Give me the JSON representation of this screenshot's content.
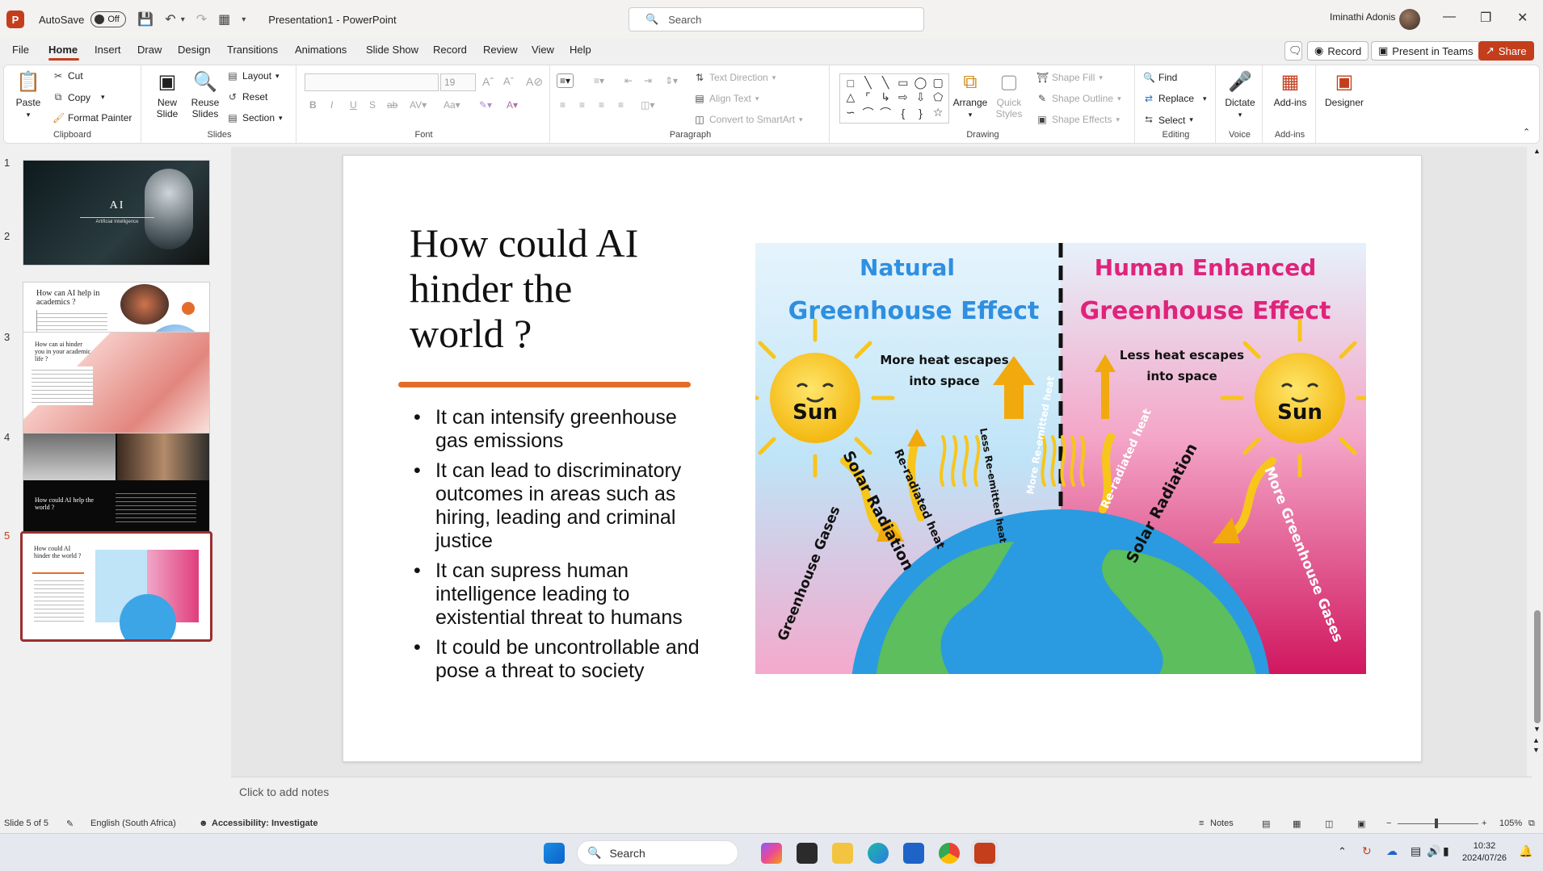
{
  "titlebar": {
    "autosave_label": "AutoSave",
    "autosave_state": "Off",
    "doc_title": "Presentation1 - PowerPoint",
    "search_placeholder": "Search",
    "user_name": "Iminathi Adonis"
  },
  "menu": {
    "tabs": [
      "File",
      "Home",
      "Insert",
      "Draw",
      "Design",
      "Transitions",
      "Animations",
      "Slide Show",
      "Record",
      "Review",
      "View",
      "Help"
    ],
    "record_btn": "Record",
    "present_btn": "Present in Teams",
    "share_btn": "Share"
  },
  "ribbon": {
    "clipboard": {
      "paste": "Paste",
      "cut": "Cut",
      "copy": "Copy",
      "format_painter": "Format Painter",
      "label": "Clipboard"
    },
    "slides": {
      "new_slide": "New Slide",
      "reuse_slides": "Reuse Slides",
      "layout": "Layout",
      "reset": "Reset",
      "section": "Section",
      "label": "Slides"
    },
    "font": {
      "size": "19",
      "label": "Font"
    },
    "paragraph": {
      "text_direction": "Text Direction",
      "align_text": "Align Text",
      "smartart": "Convert to SmartArt",
      "label": "Paragraph"
    },
    "drawing": {
      "arrange": "Arrange",
      "quick_styles": "Quick Styles",
      "shape_fill": "Shape Fill",
      "shape_outline": "Shape Outline",
      "shape_effects": "Shape Effects",
      "label": "Drawing"
    },
    "editing": {
      "find": "Find",
      "replace": "Replace",
      "select": "Select",
      "label": "Editing"
    },
    "voice": {
      "dictate": "Dictate",
      "label": "Voice"
    },
    "addins": {
      "addins": "Add-ins",
      "label": "Add-ins"
    },
    "designer": {
      "designer": "Designer"
    }
  },
  "thumbnails": [
    {
      "num": "1",
      "title": "AI",
      "subtitle": "Artificial Intelligence"
    },
    {
      "num": "2",
      "title": "How can AI help in academics ?"
    },
    {
      "num": "3",
      "title": "How can ai hinder you in your academic life ?"
    },
    {
      "num": "4",
      "title": "How could AI help the world ?"
    },
    {
      "num": "5",
      "title": "How could AI hinder the world ?"
    }
  ],
  "slide": {
    "title": "How could AI hinder the world ?",
    "bullets": [
      "It can intensify greenhouse gas emissions",
      "It can lead to discriminatory outcomes in areas such as hiring, leading and criminal justice",
      "It can supress human intelligence leading to existential threat to humans",
      "It could be uncontrollable and pose a threat to society"
    ],
    "illustration": {
      "left_title_1": "Natural",
      "left_title_2": "Greenhouse Effect",
      "right_title_1": "Human Enhanced",
      "right_title_2": "Greenhouse Effect",
      "sun": "Sun",
      "more_heat_1": "More heat escapes",
      "more_heat_2": "into space",
      "less_heat_1": "Less heat escapes",
      "less_heat_2": "into space",
      "solar": "Solar Radiation",
      "reradiated": "Re-radiated heat",
      "less_reemitted": "Less Re-emitted heat",
      "more_reemitted": "More Re-emitted heat",
      "greenhouse_gases": "Greenhouse Gases",
      "more_greenhouse_gases": "More Greenhouse Gases"
    }
  },
  "notes": {
    "placeholder": "Click to add notes"
  },
  "status": {
    "slide_of": "Slide 5 of 5",
    "language": "English (South Africa)",
    "accessibility": "Accessibility: Investigate",
    "notes": "Notes",
    "zoom": "105%"
  },
  "taskbar": {
    "search": "Search",
    "time": "10:32",
    "date": "2024/07/26"
  },
  "colors": {
    "accent": "#c43e1c",
    "title_underline": "#e46c2b",
    "natural_title": "#2f8fe0",
    "enhanced_title": "#e0237b",
    "sun": "#f8c51b"
  }
}
